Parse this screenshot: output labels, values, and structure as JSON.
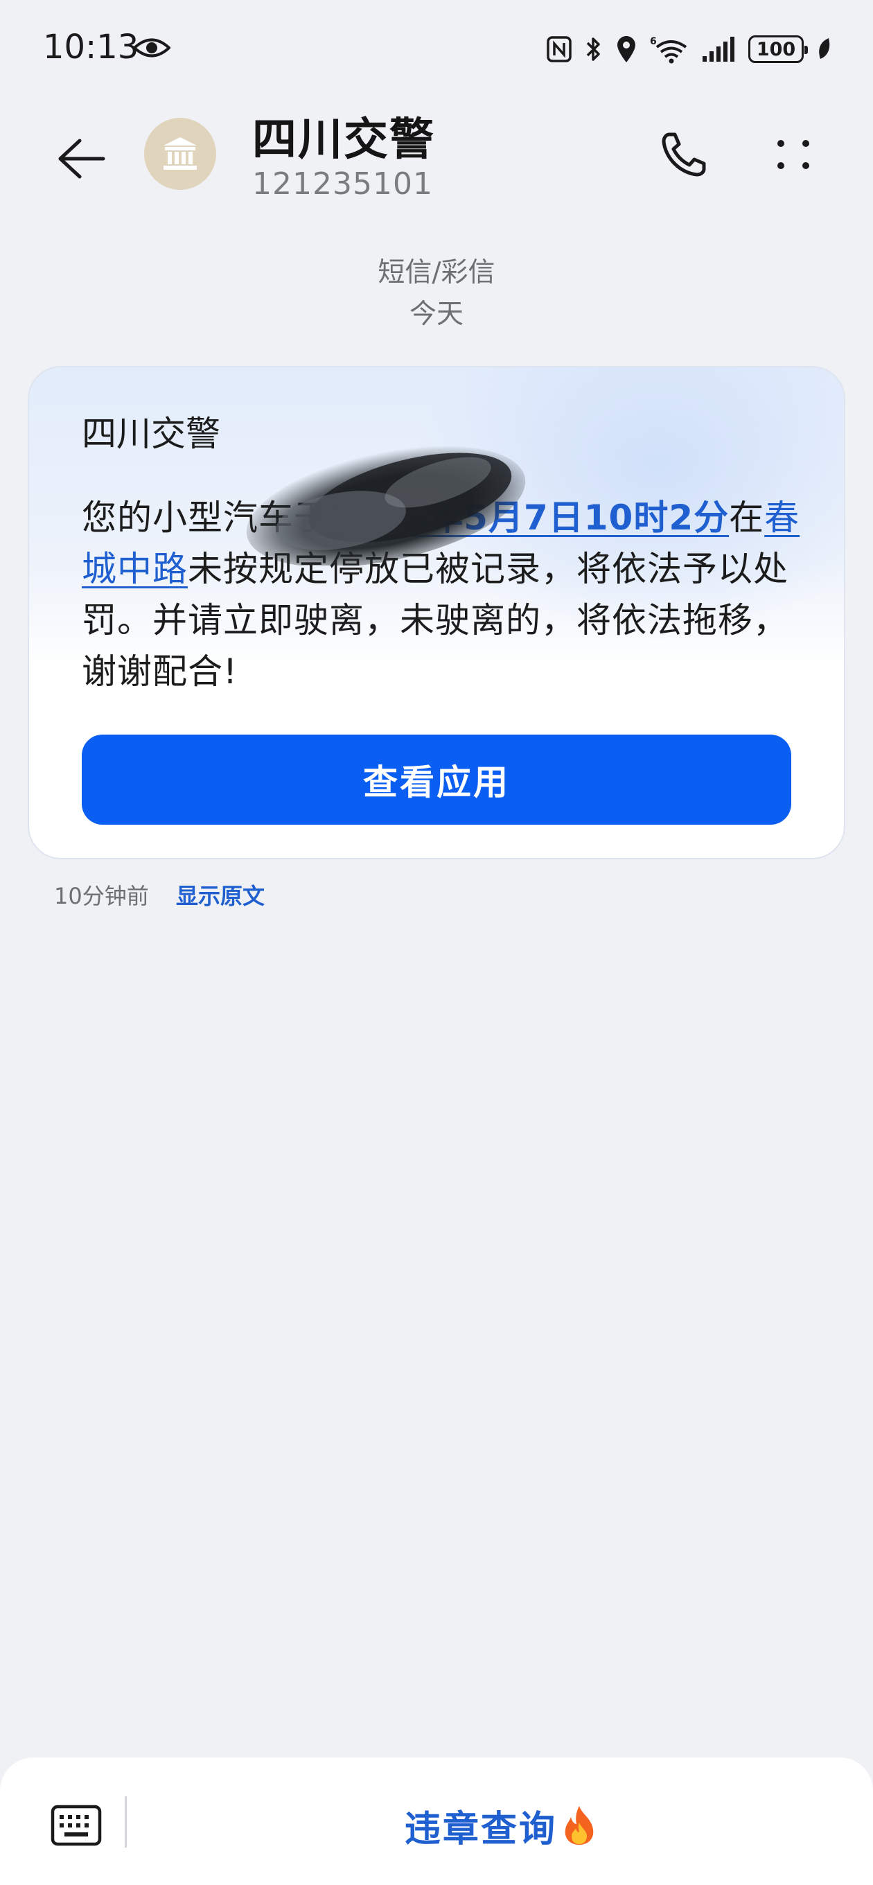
{
  "status_bar": {
    "time": "10:13",
    "battery": "100"
  },
  "header": {
    "contact_name": "四川交警",
    "contact_number": "121235101"
  },
  "thread": {
    "message_type": "短信/彩信",
    "date_label": "今天"
  },
  "card": {
    "sender": "四川交警",
    "body_prefix": "您的小型汽车",
    "body_redacted_tail": "于",
    "body_datetime_link": "2026年5月7日10时2分",
    "body_mid": "在",
    "body_place_link": "春城中路",
    "body_suffix": "未按规定停放已被记录，将依法予以处罚。并请立即驶离，未驶离的，将依法拖移，谢谢配合!",
    "button_label": "查看应用"
  },
  "meta": {
    "time_ago": "10分钟前",
    "show_original": "显示原文"
  },
  "bottom_bar": {
    "quick_action": "违章查询"
  },
  "colors": {
    "accent_blue": "#0a5ef2",
    "link_blue": "#1f5fd0",
    "background": "#f0f1f5",
    "avatar_bg": "#e0d4bd"
  },
  "icons": {
    "eye": "eye-icon",
    "nfc": "nfc-icon",
    "bluetooth": "bluetooth-icon",
    "location": "location-icon",
    "wifi": "wifi-6-icon",
    "signal": "signal-icon",
    "battery": "battery-icon",
    "leaf": "leaf-icon",
    "back": "back-arrow-icon",
    "avatar": "government-building-icon",
    "call": "phone-icon",
    "more": "more-dots-icon",
    "keyboard": "keyboard-icon",
    "fire": "fire-icon"
  }
}
